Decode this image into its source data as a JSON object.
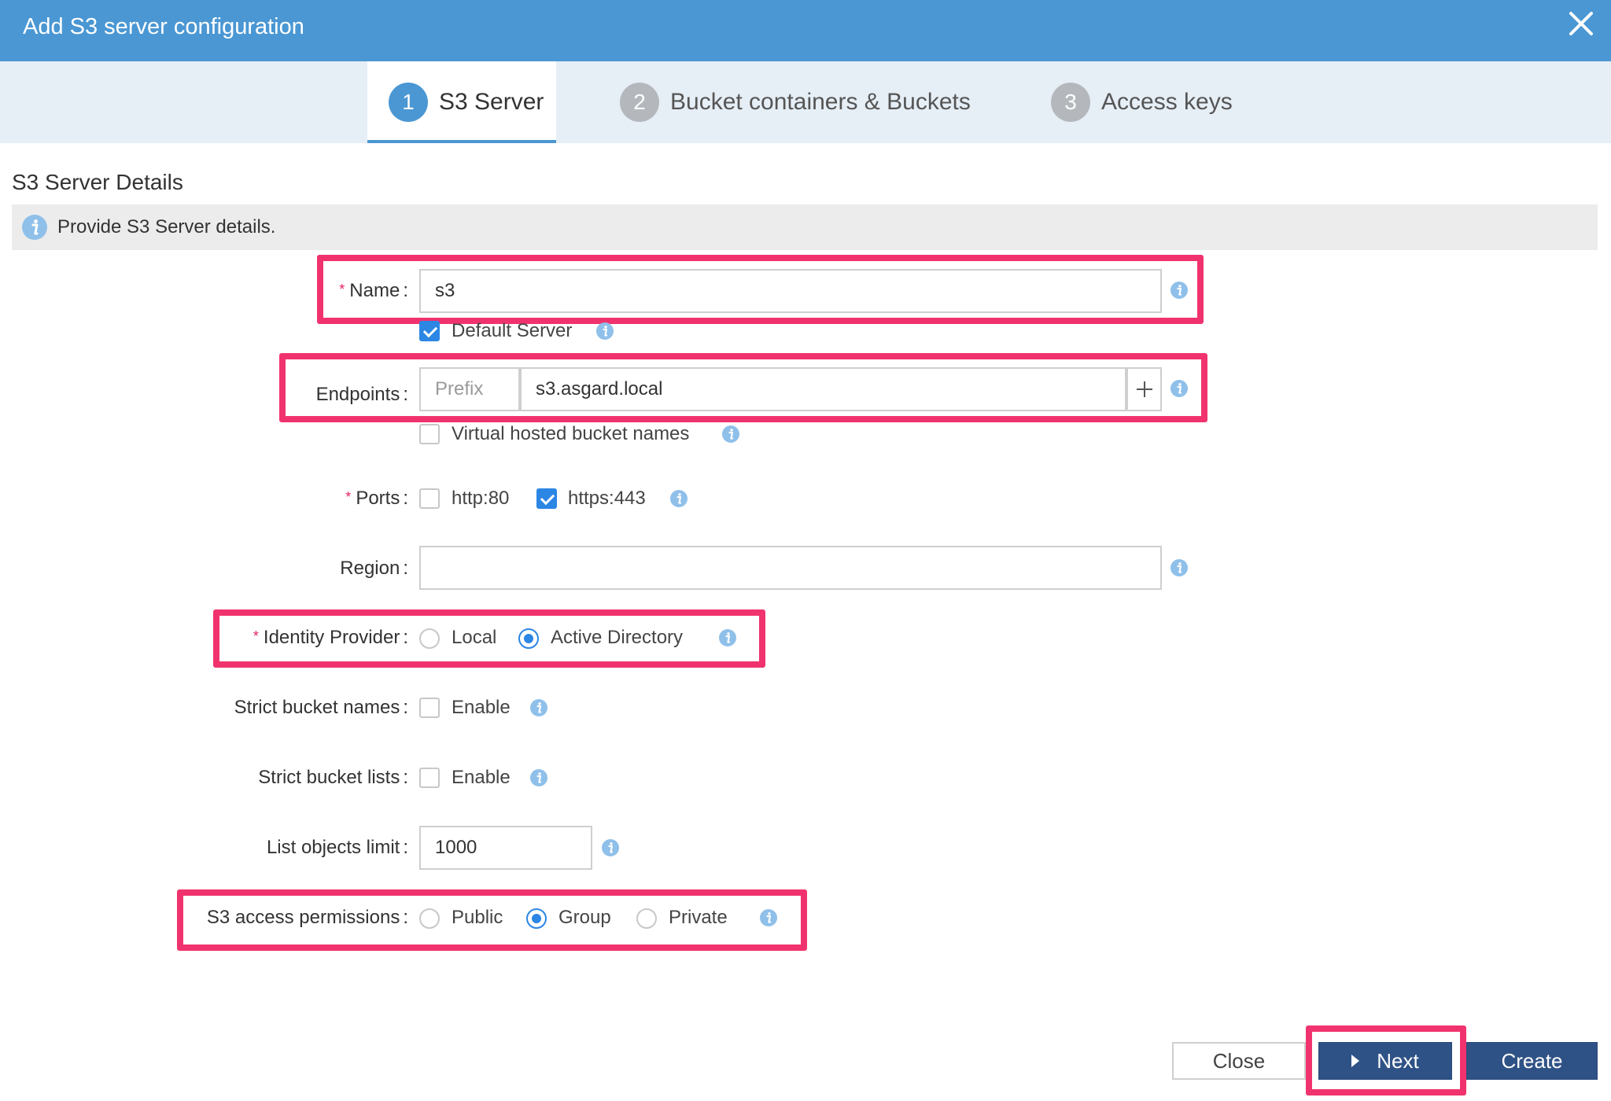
{
  "window": {
    "title": "Add S3 server configuration",
    "close_icon": "close-icon"
  },
  "steps": [
    {
      "number": "1",
      "label": "S3 Server",
      "active": true
    },
    {
      "number": "2",
      "label": "Bucket containers & Buckets",
      "active": false
    },
    {
      "number": "3",
      "label": "Access keys",
      "active": false
    }
  ],
  "section": {
    "title": "S3 Server Details",
    "info_text": "Provide S3 Server details."
  },
  "form": {
    "name": {
      "label": "Name",
      "required": true,
      "value": "s3"
    },
    "default_server": {
      "label": "Default Server",
      "checked": true
    },
    "endpoints": {
      "label": "Endpoints",
      "prefix_placeholder": "Prefix",
      "value": "s3.asgard.local",
      "add_icon": "plus-icon"
    },
    "virtual_hosted": {
      "label": "Virtual hosted bucket names",
      "checked": false
    },
    "ports": {
      "label": "Ports",
      "required": true,
      "options": [
        {
          "label": "http:80",
          "checked": false
        },
        {
          "label": "https:443",
          "checked": true
        }
      ]
    },
    "region": {
      "label": "Region",
      "value": ""
    },
    "identity_provider": {
      "label": "Identity Provider",
      "required": true,
      "options": [
        "Local",
        "Active Directory"
      ],
      "selected": "Active Directory"
    },
    "strict_bucket_names": {
      "label": "Strict bucket names",
      "option": "Enable",
      "checked": false
    },
    "strict_bucket_lists": {
      "label": "Strict bucket lists",
      "option": "Enable",
      "checked": false
    },
    "list_objects_limit": {
      "label": "List objects limit",
      "value": "1000"
    },
    "s3_access_permissions": {
      "label": "S3 access permissions",
      "options": [
        "Public",
        "Group",
        "Private"
      ],
      "selected": "Group"
    }
  },
  "footer": {
    "close_label": "Close",
    "next_label": "Next",
    "create_label": "Create"
  },
  "colors": {
    "header": "#4a97d3",
    "steps_bar": "#e6eef6",
    "accent": "#2b86e4",
    "highlight": "#f0336e",
    "primary_button": "#2f5286"
  }
}
